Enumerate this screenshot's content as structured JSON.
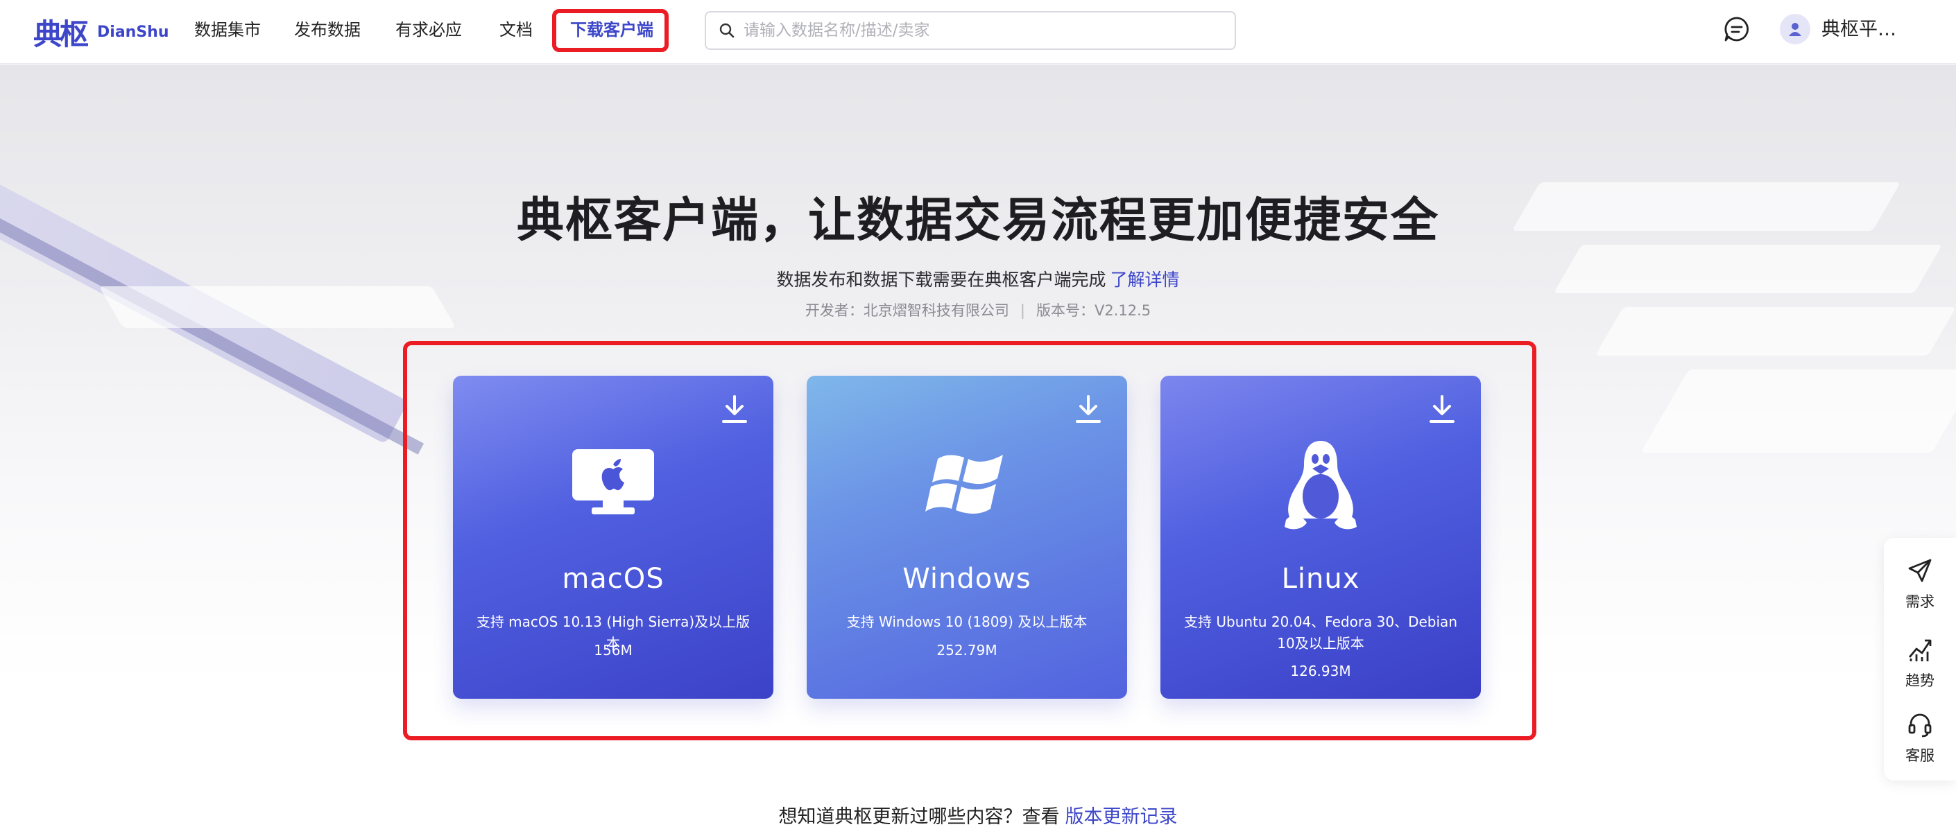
{
  "header": {
    "logo_cn": "典枢",
    "logo_en": "DianShu",
    "nav": [
      {
        "label": "数据集市"
      },
      {
        "label": "发布数据"
      },
      {
        "label": "有求必应"
      },
      {
        "label": "文档"
      },
      {
        "label": "下载客户端",
        "active": true
      }
    ],
    "search": {
      "placeholder": "请输入数据名称/描述/卖家",
      "value": ""
    },
    "user_name": "典枢平…"
  },
  "hero": {
    "title": "典枢客户端，让数据交易流程更加便捷安全",
    "subtitle": "数据发布和数据下载需要在典枢客户端完成",
    "subtitle_link": "了解详情",
    "developer": "开发者：北京熠智科技有限公司",
    "version": "版本号：V2.12.5"
  },
  "downloads": [
    {
      "os": "macOS",
      "requirement": "支持 macOS 10.13 (High Sierra)及以上版本",
      "size": "156M",
      "icon": "apple-monitor-icon"
    },
    {
      "os": "Windows",
      "requirement": "支持 Windows 10 (1809) 及以上版本",
      "size": "252.79M",
      "icon": "windows-logo-icon"
    },
    {
      "os": "Linux",
      "requirement": "支持 Ubuntu 20.04、Fedora 30、Debian 10及以上版本",
      "size": "126.93M",
      "icon": "tux-penguin-icon"
    }
  ],
  "footer": {
    "text": "想知道典枢更新过哪些内容？查看",
    "link": "版本更新记录"
  },
  "float_bar": [
    {
      "label": "需求",
      "icon": "send-icon"
    },
    {
      "label": "趋势",
      "icon": "trend-chart-icon"
    },
    {
      "label": "客服",
      "icon": "headset-icon"
    }
  ],
  "colors": {
    "brand": "#3d46c9",
    "highlight_box": "#ec1c24"
  }
}
